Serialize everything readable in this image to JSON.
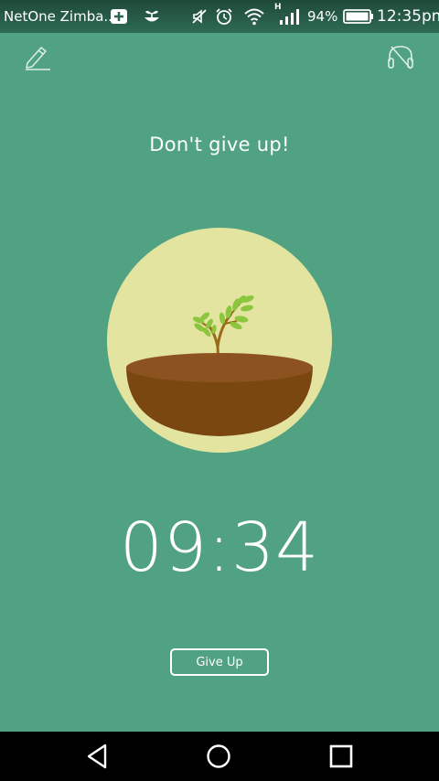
{
  "status_bar": {
    "carrier": "NetOne Zimba...",
    "battery": "94%",
    "time": "12:35pm",
    "network_type": "H",
    "icons": [
      "plus-box-icon",
      "sprout-icon",
      "mute-icon",
      "alarm-icon",
      "wifi-icon",
      "signal-icon",
      "battery-icon"
    ]
  },
  "toolbar": {
    "left_icon": "pencil-icon",
    "right_icon": "headphones-off-icon"
  },
  "main": {
    "headline": "Don't give up!",
    "timer": "09:34",
    "give_up_label": "Give Up"
  },
  "colors": {
    "background": "#50a283",
    "circle": "#e4e4a1",
    "pot": "#7a4710",
    "soil": "#8c5220",
    "leaf": "#8cc63f"
  },
  "nav_bar": {
    "icons": [
      "back-icon",
      "home-icon",
      "recents-icon"
    ]
  }
}
